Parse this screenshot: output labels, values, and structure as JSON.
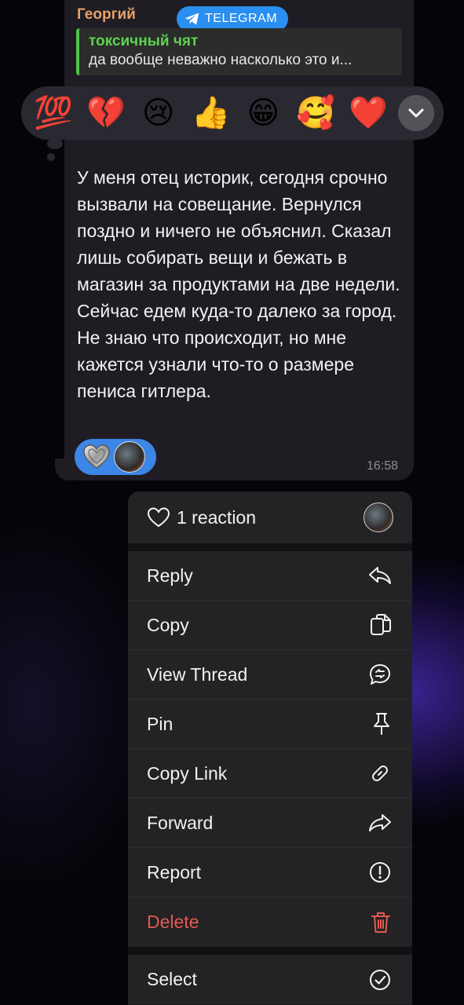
{
  "message": {
    "sender": "Георгий",
    "badge_label": "TELEGRAM",
    "reply": {
      "title": "токсичный чят",
      "text": "да вообще неважно насколько это и..."
    },
    "text": "У меня отец историк, сегодня срочно вызвали на совещание. Вернулся поздно и ничего не объяснил. Сказал лишь собирать вещи и бежать в магазин за продуктами на две недели. Сейчас едем куда-то далеко за город. Не знаю что происходит, но мне кажется узнали что-то о размере пениса гитлера.",
    "time": "16:58",
    "reactions": [
      {
        "icon": "silver-heart-icon"
      },
      {
        "icon": "user-avatar"
      }
    ]
  },
  "reaction_picker": {
    "emojis": [
      "💯",
      "💔",
      "😢",
      "👍",
      "😁",
      "🥰",
      "❤️"
    ],
    "expand_icon": "chevron-down-icon"
  },
  "menu": {
    "reaction_summary": "1 reaction",
    "items": [
      {
        "label": "Reply",
        "icon": "reply-icon"
      },
      {
        "label": "Copy",
        "icon": "copy-icon"
      },
      {
        "label": "View Thread",
        "icon": "thread-icon"
      },
      {
        "label": "Pin",
        "icon": "pin-icon"
      },
      {
        "label": "Copy Link",
        "icon": "link-icon"
      },
      {
        "label": "Forward",
        "icon": "forward-icon"
      },
      {
        "label": "Report",
        "icon": "report-icon"
      },
      {
        "label": "Delete",
        "icon": "trash-icon",
        "destructive": true
      },
      {
        "label": "Select",
        "icon": "select-icon"
      }
    ]
  },
  "colors": {
    "sender": "#e8a06a",
    "reply_accent": "#4ec54a",
    "badge": "#2a8ff0",
    "reactions_pill": "#3b86e6",
    "destructive": "#e35a4f"
  }
}
